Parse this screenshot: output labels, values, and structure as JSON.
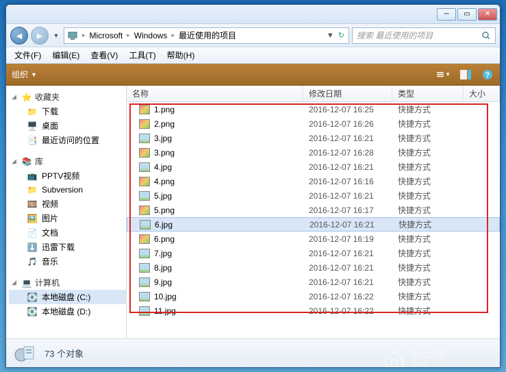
{
  "breadcrumbs": [
    "Microsoft",
    "Windows",
    "最近使用的项目"
  ],
  "search": {
    "placeholder": "搜索 最近使用的项目"
  },
  "menubar": [
    {
      "label": "文件(F)"
    },
    {
      "label": "编辑(E)"
    },
    {
      "label": "查看(V)"
    },
    {
      "label": "工具(T)"
    },
    {
      "label": "帮助(H)"
    }
  ],
  "toolbar": {
    "organize": "组织"
  },
  "sidebar": {
    "favorites": {
      "title": "收藏夹",
      "items": [
        "下载",
        "桌面",
        "最近访问的位置"
      ]
    },
    "libraries": {
      "title": "库",
      "items": [
        "PPTV视频",
        "Subversion",
        "视频",
        "图片",
        "文档",
        "迅雷下载",
        "音乐"
      ]
    },
    "computer": {
      "title": "计算机",
      "items": [
        "本地磁盘 (C:)",
        "本地磁盘 (D:)"
      ]
    }
  },
  "columns": {
    "name": "名称",
    "date": "修改日期",
    "type": "类型",
    "size": "大小"
  },
  "files": [
    {
      "name": "1.png",
      "date": "2016-12-07 16:25",
      "type": "快捷方式",
      "ext": "png"
    },
    {
      "name": "2.png",
      "date": "2016-12-07 16:26",
      "type": "快捷方式",
      "ext": "png"
    },
    {
      "name": "3.jpg",
      "date": "2016-12-07 16:21",
      "type": "快捷方式",
      "ext": "jpg"
    },
    {
      "name": "3.png",
      "date": "2016-12-07 16:28",
      "type": "快捷方式",
      "ext": "png"
    },
    {
      "name": "4.jpg",
      "date": "2016-12-07 16:21",
      "type": "快捷方式",
      "ext": "jpg"
    },
    {
      "name": "4.png",
      "date": "2016-12-07 16:16",
      "type": "快捷方式",
      "ext": "png"
    },
    {
      "name": "5.jpg",
      "date": "2016-12-07 16:21",
      "type": "快捷方式",
      "ext": "jpg"
    },
    {
      "name": "5.png",
      "date": "2016-12-07 16:17",
      "type": "快捷方式",
      "ext": "png"
    },
    {
      "name": "6.jpg",
      "date": "2016-12-07 16:21",
      "type": "快捷方式",
      "ext": "jpg",
      "selected": true
    },
    {
      "name": "6.png",
      "date": "2016-12-07 16:19",
      "type": "快捷方式",
      "ext": "png"
    },
    {
      "name": "7.jpg",
      "date": "2016-12-07 16:21",
      "type": "快捷方式",
      "ext": "jpg"
    },
    {
      "name": "8.jpg",
      "date": "2016-12-07 16:21",
      "type": "快捷方式",
      "ext": "jpg"
    },
    {
      "name": "9.jpg",
      "date": "2016-12-07 16:21",
      "type": "快捷方式",
      "ext": "jpg"
    },
    {
      "name": "10.jpg",
      "date": "2016-12-07 16:22",
      "type": "快捷方式",
      "ext": "jpg"
    },
    {
      "name": "11.jpg",
      "date": "2016-12-07 16:22",
      "type": "快捷方式",
      "ext": "jpg"
    }
  ],
  "status": {
    "count": "73 个对象"
  },
  "watermark": {
    "brand": "系统之家",
    "url": "WWW.XITONGZHIJIA.NET"
  }
}
